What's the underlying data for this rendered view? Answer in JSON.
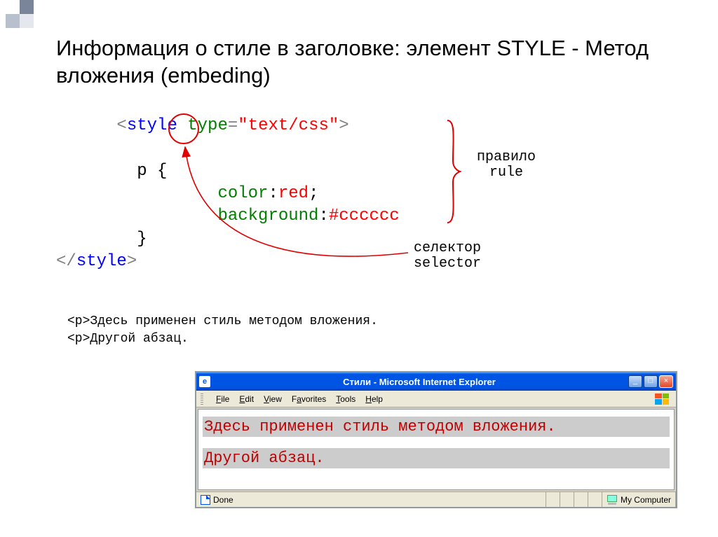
{
  "title": "Информация о стиле в заголовке: элемент STYLE - Метод вложения (embeding)",
  "code": {
    "tag_open_bracket": "<",
    "tag_name": "style",
    "attr_name": "type",
    "attr_eq": "=",
    "attr_val": "\"text/css\"",
    "tag_close_bracket": ">",
    "selector": "p",
    "brace_open": "{",
    "prop1_name": "color",
    "prop1_colon": ":",
    "prop1_val": "red",
    "semicolon": ";",
    "prop2_name": "background",
    "prop2_colon": ":",
    "prop2_val": "#cccccc",
    "brace_close": "}",
    "end_tag_open": "</",
    "end_tag_close": ">"
  },
  "labels": {
    "rule_ru": "правило",
    "rule_en": "rule",
    "selector_ru": "селектор",
    "selector_en": "selector"
  },
  "example": {
    "p1": "<p>Здесь применен стиль методом вложения.",
    "p2": "<p>Другой абзац."
  },
  "ie": {
    "title": "Стили - Microsoft Internet Explorer",
    "menu": [
      "File",
      "Edit",
      "View",
      "Favorites",
      "Tools",
      "Help"
    ],
    "content": {
      "line1": "Здесь применен стиль методом вложения.",
      "line2": "Другой абзац."
    },
    "status": {
      "done": "Done",
      "zone": "My Computer"
    }
  }
}
